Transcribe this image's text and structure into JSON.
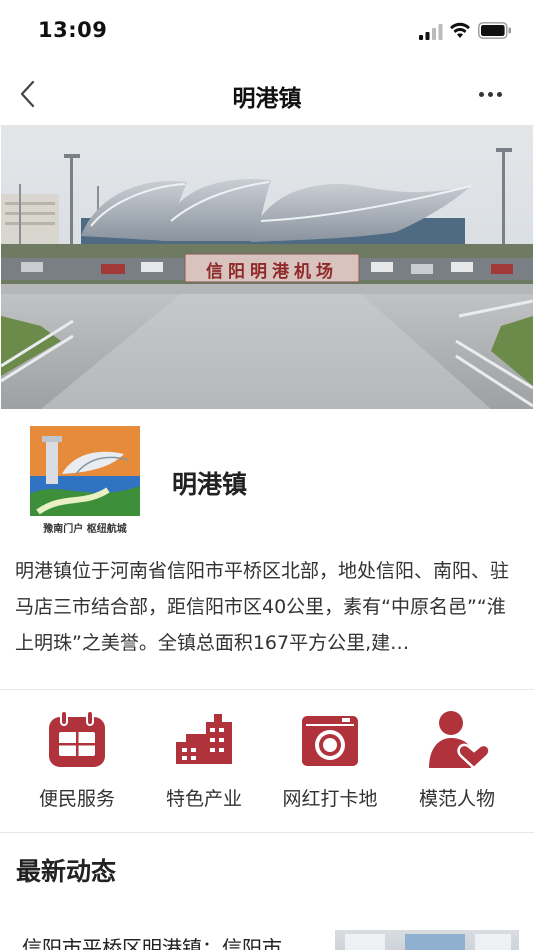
{
  "status": {
    "time": "13:09"
  },
  "nav": {
    "title": "明港镇"
  },
  "banner": {
    "sign_text": "信阳明港机场"
  },
  "logo": {
    "caption": "豫南门户 枢纽航城"
  },
  "intro": {
    "name": "明港镇",
    "description": "明港镇位于河南省信阳市平桥区北部，地处信阳、南阳、驻马店三市结合部，距信阳市区40公里，素有“中原名邑”“淮上明珠”之美誉。全镇总面积167平方公里,建…"
  },
  "services": [
    {
      "label": "便民服务",
      "icon": "calendar-icon"
    },
    {
      "label": "特色产业",
      "icon": "factory-icon"
    },
    {
      "label": "网红打卡地",
      "icon": "camera-icon"
    },
    {
      "label": "模范人物",
      "icon": "person-heart-icon"
    }
  ],
  "colors": {
    "accent": "#b0333b"
  },
  "news": {
    "section_title": "最新动态",
    "items": [
      {
        "title": "信阳市平桥区明港镇：信阳市"
      }
    ]
  }
}
